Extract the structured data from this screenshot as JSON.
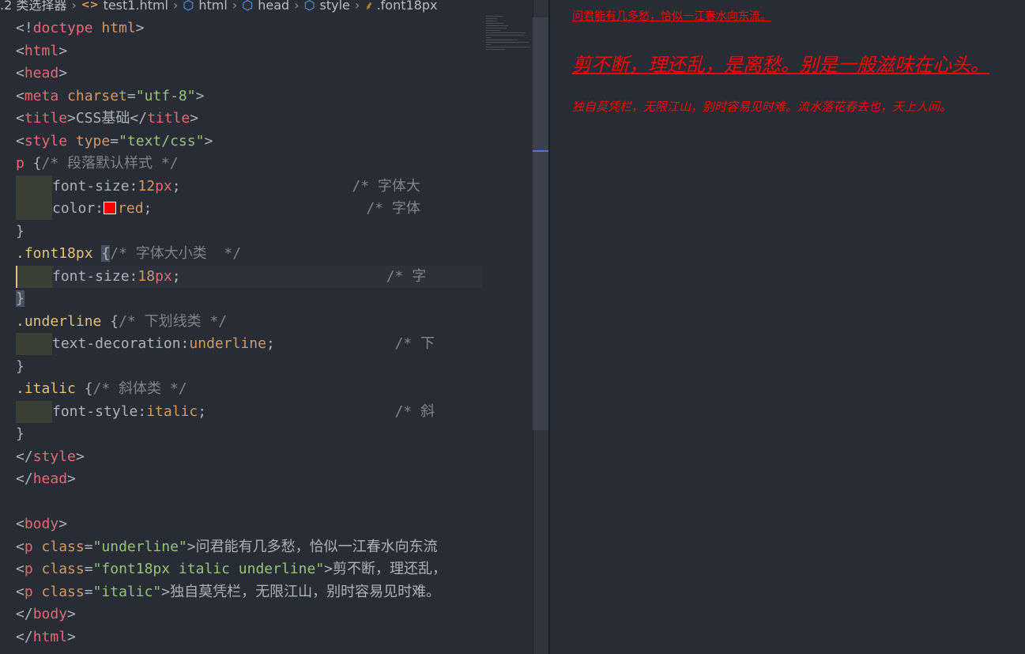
{
  "breadcrumb": {
    "folder": ".2 类选择器",
    "file": "test1.html",
    "crumbs": [
      "html",
      "head",
      "style"
    ],
    "current": ".font18px"
  },
  "code": {
    "l1": {
      "a": "<!",
      "b": "doctype",
      "c": " html",
      "d": ">"
    },
    "l2": {
      "a": "<",
      "b": "html",
      "c": ">"
    },
    "l3": {
      "a": "<",
      "b": "head",
      "c": ">"
    },
    "l4": {
      "a": "<",
      "b": "meta",
      "c": " charset",
      "d": "=",
      "e": "\"utf-8\"",
      "f": ">"
    },
    "l5": {
      "a": "<",
      "b": "title",
      "c": ">",
      "d": "CSS基础",
      "e": "</",
      "f": "title",
      "g": ">"
    },
    "l6": {
      "a": "<",
      "b": "style",
      "c": " type",
      "d": "=",
      "e": "\"text/css\"",
      "f": ">"
    },
    "l7": {
      "sel": "p",
      "brace": " {",
      "cmt": "/* 段落默认样式 */"
    },
    "l8": {
      "prop": "font-size:",
      "num": "12",
      "unit": "px",
      "semi": ";",
      "pad": "                    ",
      "cmt": "/* 字体大"
    },
    "l9": {
      "prop": "color:",
      "val": "red",
      "semi": ";",
      "pad": "                         ",
      "cmt": "/* 字体"
    },
    "l10": {
      "brace": "}"
    },
    "l11": {
      "sel": ".font18px",
      "sp": " ",
      "brace": "{",
      "cmt": "/* 字体大小类  */"
    },
    "l12": {
      "prop": "font-size:",
      "num": "18",
      "unit": "px",
      "semi": ";",
      "pad": "                        ",
      "cmt": "/* 字"
    },
    "l13": {
      "brace": "}"
    },
    "l14": {
      "sel": ".underline",
      "brace": " {",
      "cmt": "/* 下划线类 */"
    },
    "l15": {
      "prop": "text-decoration:",
      "val": "underline",
      "semi": ";",
      "pad": "              ",
      "cmt": "/* 下"
    },
    "l16": {
      "brace": "}"
    },
    "l17": {
      "sel": ".italic",
      "brace": " {",
      "cmt": "/* 斜体类 */"
    },
    "l18": {
      "prop": "font-style:",
      "val": "italic",
      "semi": ";",
      "pad": "                      ",
      "cmt": "/* 斜"
    },
    "l19": {
      "brace": "}"
    },
    "l20": {
      "a": "</",
      "b": "style",
      "c": ">"
    },
    "l21": {
      "a": "</",
      "b": "head",
      "c": ">"
    },
    "l23": {
      "a": "<",
      "b": "body",
      "c": ">"
    },
    "l24": {
      "a": "<",
      "b": "p",
      "c": " class",
      "d": "=",
      "e": "\"underline\"",
      "f": ">",
      "g": "问君能有几多愁，恰似一江春水向东流"
    },
    "l25": {
      "a": "<",
      "b": "p",
      "c": " class",
      "d": "=",
      "e": "\"font18px italic underline\"",
      "f": ">",
      "g": "剪不断，理还乱，"
    },
    "l26": {
      "a": "<",
      "b": "p",
      "c": " class",
      "d": "=",
      "e": "\"italic\"",
      "f": ">",
      "g": "独自莫凭栏，无限江山，别时容易见时难。"
    },
    "l27": {
      "a": "</",
      "b": "body",
      "c": ">"
    },
    "l28": {
      "a": "</",
      "b": "html",
      "c": ">"
    }
  },
  "preview": {
    "p1": "问君能有几多愁，恰似一江春水向东流。",
    "p2": "剪不断，理还乱，是离愁。别是一般滋味在心头。",
    "p3": "独自莫凭栏，无限江山，别时容易见时难。流水落花春去也，天上人间。"
  },
  "colors": {
    "background": "#282c34",
    "preview_text": "#ff0000",
    "tag": "#e06c75",
    "string": "#98c379",
    "comment": "#7f848e",
    "selector": "#e5c07b",
    "number": "#d19a66"
  }
}
